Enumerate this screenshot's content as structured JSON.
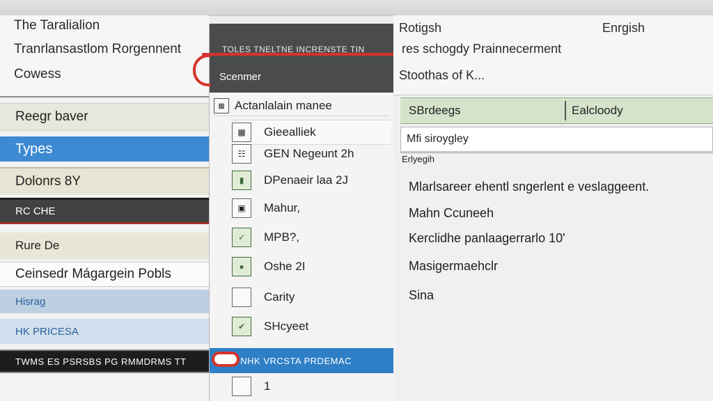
{
  "left_panel": {
    "headers": [
      "The Taralialion",
      "Tranrlansastlom Rorgennent",
      "Cowess"
    ],
    "rows": [
      "Reegr baver",
      "Types",
      "Dolonrs 8Y",
      "RC CHE",
      "Rure De",
      "Ceinsedr Mágargein Pobls",
      "Hisrag",
      "HK PRICESA",
      "TWMS ES PSRSBS PG RMMDRMS TT"
    ]
  },
  "menu_panel": {
    "header_line": "TOLES TNELTNE INCRENSTE TIN",
    "header_sub": "Scenmer",
    "title": "Actanlalain manee",
    "title_icon": "grid-icon",
    "items": [
      {
        "label": "Gieealliek",
        "icon": "grid-icon"
      },
      {
        "label": "GEN Negeunt 2h",
        "icon": "table-icon"
      },
      {
        "label": "DPenaeir laa 2J",
        "icon": "book-icon"
      },
      {
        "label": "Mahur,",
        "icon": "image-icon"
      },
      {
        "label": "MPB?,",
        "icon": "check-icon"
      },
      {
        "label": "Oshe 2I",
        "icon": "globe-icon"
      },
      {
        "label": "Carity",
        "icon": "document-icon"
      },
      {
        "label": "SHcyeet",
        "icon": "chart-icon"
      }
    ],
    "highlight_row": "F3 NHK VRCSTA PRDEMAC",
    "last_item": "1",
    "accent": "#2f7fc6",
    "annotation_color": "#d5332b"
  },
  "right_panel": {
    "title": "Rotigsh",
    "language": "Enrgish",
    "subtitle": "res schogdy Prainnecerment",
    "status": "Stoothas of K...",
    "column_left": "SBrdeegs",
    "column_right": "Ealcloody",
    "input_value": "Mfi siroygley",
    "small_label": "Erlyegih",
    "lines": [
      "Mlarlsareer ehentl sngerlent e veslaggeent.",
      "Mahn Ccuneeh",
      "Kerclidhe panlaagerrarlo 10'",
      "Masigermaehclr",
      "Sina"
    ]
  }
}
